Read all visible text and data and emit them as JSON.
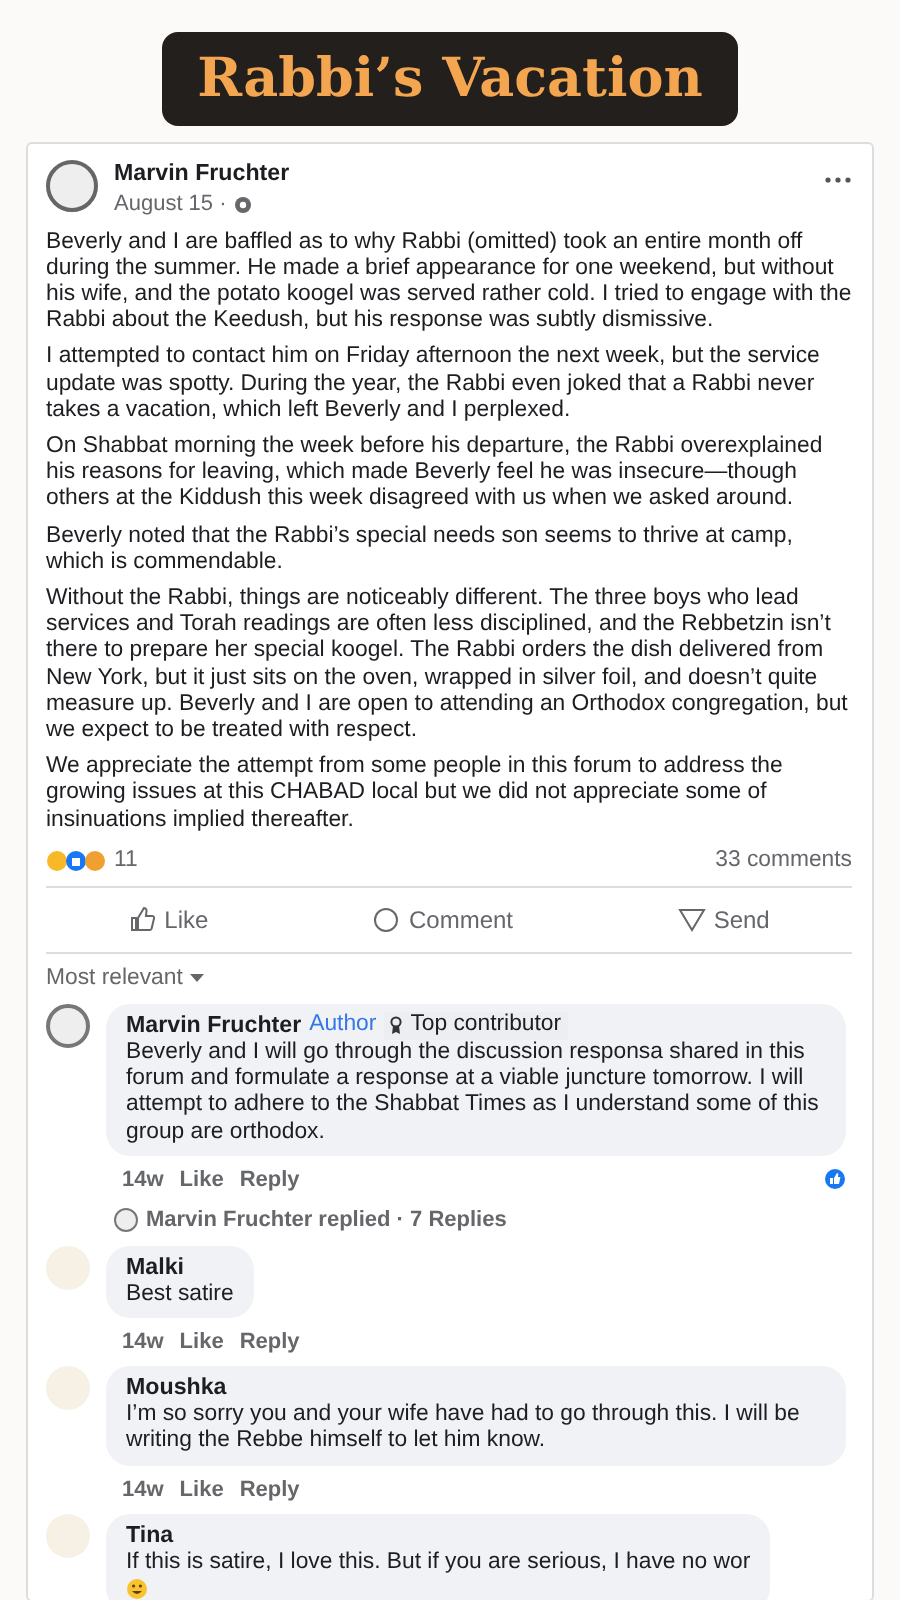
{
  "banner": {
    "title": "Rabbi’s Vacation"
  },
  "post": {
    "author": "Marvin Fruchter",
    "date": "August 15 ·",
    "paragraphs": [
      "Beverly and I are baffled as to why Rabbi (omitted) took an entire month off during the summer. He made a brief appearance for one weekend, but without his wife, and the potato koogel was served rather cold. I tried to engage with the Rabbi about the Keedush, but his response was subtly dismissive.",
      "I attempted to contact him on Friday afternoon the next week, but the service update was spotty. During the year, the Rabbi even joked that a Rabbi never takes a vacation, which left Beverly and I perplexed.",
      "On Shabbat morning the week before his departure, the Rabbi overexplained his reasons for leaving, which made Beverly feel he was insecure—though others at the Kiddush this week disagreed with us when we asked around.",
      "Beverly noted that the Rabbi’s special needs son seems to thrive at camp, which is commendable.",
      "Without the Rabbi, things are noticeably different. The three boys who lead services and Torah readings are often less disciplined, and the Rebbetzin isn’t there to prepare her special koogel. The Rabbi orders the dish delivered from New York, but it just sits on the oven, wrapped in silver foil, and doesn’t quite measure up. Beverly and I are open to attending an Orthodox congregation, but we expect to be treated with respect.",
      "We appreciate the attempt from some people in this forum to address the growing issues at this CHABAD local but we did not appreciate some of insinuations implied thereafter."
    ],
    "reaction_count": "11",
    "comment_count": "33 comments",
    "actions": [
      {
        "kind": "like",
        "label": "Like"
      },
      {
        "kind": "comment",
        "label": "Comment"
      },
      {
        "kind": "send",
        "label": "Send"
      }
    ],
    "sort": "Most relevant"
  },
  "comments": [
    {
      "author": "Marvin Fruchter",
      "author_tag": "Author",
      "badge": "Top contributor",
      "text": "Beverly and I will go through the discussion responsa shared in this forum and formulate a response  at a viable juncture tomorrow. I will attempt to adhere to the Shabbat Times as I understand some of this group are orthodox.",
      "time": "14w",
      "like": "Like",
      "reply": "Reply",
      "liked": true,
      "replies": "Marvin Fruchter replied · 7 Replies"
    },
    {
      "author": "Malki",
      "text": "Best satire",
      "time": "14w",
      "like": "Like",
      "reply": "Reply",
      "liked": false
    },
    {
      "author": "Moushka",
      "text": "I’m so sorry you and your wife have had to go through this. I will be writing the Rebbe himself to let him know.",
      "time": "14w",
      "like": "Like",
      "reply": "Reply",
      "liked": false
    },
    {
      "author": "Tina",
      "text": "If this is satire, I love this. But if you are serious, I have no wor",
      "emoji": true,
      "liked": false
    }
  ]
}
